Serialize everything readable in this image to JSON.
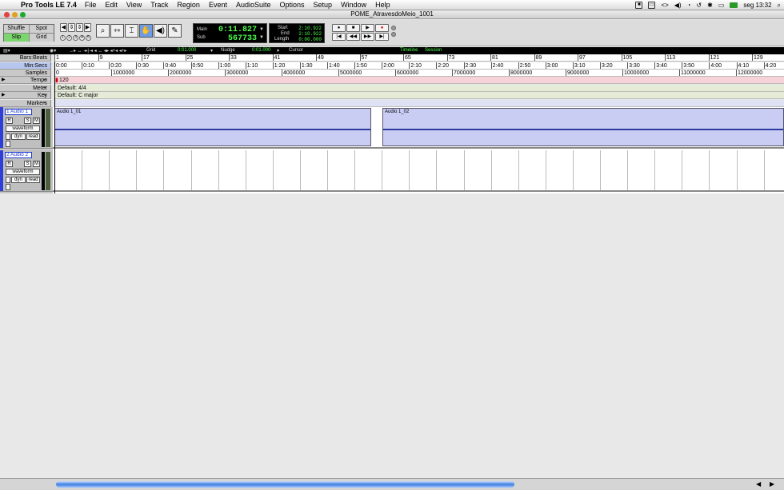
{
  "menubar": {
    "app": "Pro Tools LE 7.4",
    "items": [
      "File",
      "Edit",
      "View",
      "Track",
      "Region",
      "Event",
      "AudioSuite",
      "Options",
      "Setup",
      "Window",
      "Help"
    ],
    "clock": "seg 13:32"
  },
  "window": {
    "title": "POME_AtravesdoMeio_1001"
  },
  "modes": {
    "shuffle": "Shuffle",
    "spot": "Spot",
    "slip": "Slip",
    "grid": "Grid"
  },
  "counter": {
    "main_label": "Main",
    "sub_label": "Sub",
    "main_value": "0:11.827",
    "sub_value": "567733"
  },
  "selection": {
    "start_label": "Start",
    "end_label": "End",
    "length_label": "Length",
    "start": "2:10.922",
    "end": "2:10.922",
    "length": "0:00.000"
  },
  "rulerbar": {
    "grid_label": "Grid",
    "grid_value": "0:01.000",
    "nudge_label": "Nudge",
    "nudge_value": "0:01.000",
    "cursor_label": "Cursor",
    "timeline_label": "Timeline",
    "session_label": "Session"
  },
  "rulers": {
    "bars_label": "Bars:Beats",
    "minsecs_label": "Min:Secs",
    "samples_label": "Samples",
    "tempo_label": "Tempo",
    "meter_label": "Meter",
    "key_label": "Key",
    "markers_label": "Markers",
    "bars": [
      "1",
      "9",
      "17",
      "25",
      "33",
      "41",
      "49",
      "57",
      "65",
      "73",
      "81",
      "89",
      "97",
      "105",
      "113",
      "121",
      "129"
    ],
    "minsecs": [
      "0:00",
      "0:10",
      "0:20",
      "0:30",
      "0:40",
      "0:50",
      "1:00",
      "1:10",
      "1:20",
      "1:30",
      "1:40",
      "1:50",
      "2:00",
      "2:10",
      "2:20",
      "2:30",
      "2:40",
      "2:50",
      "3:00",
      "3:10",
      "3:20",
      "3:30",
      "3:40",
      "3:50",
      "4:00",
      "4:10",
      "4:20"
    ],
    "samples": [
      "0",
      "1000000",
      "2000000",
      "3000000",
      "4000000",
      "5000000",
      "6000000",
      "7000000",
      "8000000",
      "9000000",
      "10000000",
      "11000000",
      "12000000"
    ],
    "tempo_value": "120",
    "meter_value": "Default: 4/4",
    "key_value": "Default: C major"
  },
  "tracks": [
    {
      "name": "1 Audio 1",
      "view": "waveform",
      "rec": "R",
      "solo": "S",
      "mute": "M",
      "dyn": "dyn",
      "auto": "read",
      "regions": [
        {
          "name": "Audio 1_01"
        },
        {
          "name": "Audio 1_02"
        }
      ]
    },
    {
      "name": "2 Audio 2",
      "view": "waveform",
      "rec": "R",
      "solo": "S",
      "mute": "M",
      "dyn": "dyn",
      "auto": "read",
      "regions": []
    }
  ],
  "colors": {
    "accent": "#2f3ed8",
    "counter_green": "#4cff4c",
    "region": "#c9cdf4",
    "scroll": "#3c7fe0"
  }
}
